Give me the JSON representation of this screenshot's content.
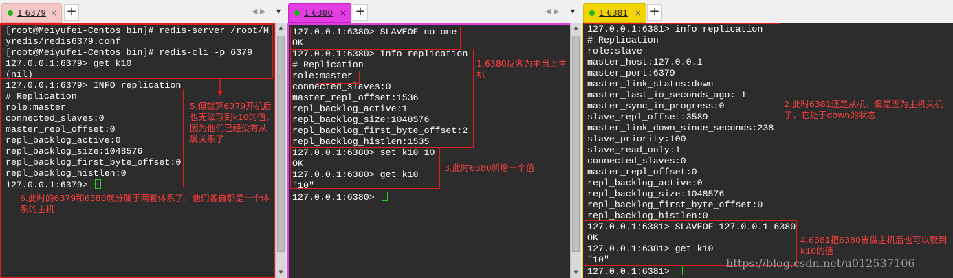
{
  "panes": [
    {
      "tab_label": "1 6379",
      "tab_close": "×",
      "tab_color": "#f5c8c8",
      "active": false,
      "lines": [
        "[root@Meiyufei-Centos bin]# redis-server /root/M",
        "yredis/redis6379.conf",
        "[root@Meiyufei-Centos bin]# redis-cli -p 6379",
        "127.0.0.1:6379> get k10",
        "(nil)",
        "127.0.0.1:6379> INFO replication",
        "# Replication",
        "role:master",
        "connected_slaves:0",
        "master_repl_offset:0",
        "repl_backlog_active:0",
        "repl_backlog_size:1048576",
        "repl_backlog_first_byte_offset:0",
        "repl_backlog_histlen:0",
        "127.0.0.1:6379> "
      ],
      "notes": [
        "5.但就算6379开机后也无法取到k10的值，因为他们已经没有从属关系了",
        "6.此时的6379和6380就分属于两套体系了，他们各自都是一个体系的主机"
      ]
    },
    {
      "tab_label": "1 6380",
      "tab_close": "×",
      "tab_color": "#e33ee3",
      "active": true,
      "lines": [
        "127.0.0.1:6380> SLAVEOF no one",
        "OK",
        "127.0.0.1:6380> info replication",
        "# Replication",
        "role:master",
        "connected_slaves:0",
        "master_repl_offset:1536",
        "repl_backlog_active:1",
        "repl_backlog_size:1048576",
        "repl_backlog_first_byte_offset:2",
        "repl_backlog_histlen:1535",
        "127.0.0.1:6380> set k10 10",
        "OK",
        "127.0.0.1:6380> get k10",
        "\"10\"",
        "127.0.0.1:6380> "
      ],
      "notes": [
        "1.6380反客为主当上主机",
        "3.此时6380新增一个值"
      ]
    },
    {
      "tab_label": "1 6381",
      "tab_close": "×",
      "tab_color": "#f2d400",
      "active": false,
      "lines": [
        "127.0.0.1:6381> info replication",
        "# Replication",
        "role:slave",
        "master_host:127.0.0.1",
        "master_port:6379",
        "master_link_status:down",
        "master_last_io_seconds_ago:-1",
        "master_sync_in_progress:0",
        "slave_repl_offset:3589",
        "master_link_down_since_seconds:238",
        "slave_priority:100",
        "slave_read_only:1",
        "connected_slaves:0",
        "master_repl_offset:0",
        "repl_backlog_active:0",
        "repl_backlog_size:1048576",
        "repl_backlog_first_byte_offset:0",
        "repl_backlog_histlen:0",
        "127.0.0.1:6381> SLAVEOF 127.0.0.1 6380",
        "OK",
        "127.0.0.1:6381> get k10",
        "\"10\"",
        "127.0.0.1:6381> "
      ],
      "notes": [
        "2.此时6381还是从机，但是因为主机关机了，它处于down的状态",
        "4.6381把6380当做主机后也可以取到k10的值"
      ]
    }
  ],
  "controls": {
    "new_tab": "+",
    "nav_arrows": "◀ ▶",
    "menu_caret": "▼"
  },
  "watermark": "https://blog.csdn.net/u012537106",
  "colors": {
    "terminal_bg": "#2c2c2c",
    "terminal_text": "#ffffff",
    "annotation": "#e01c1c",
    "cursor": "#23d023"
  }
}
